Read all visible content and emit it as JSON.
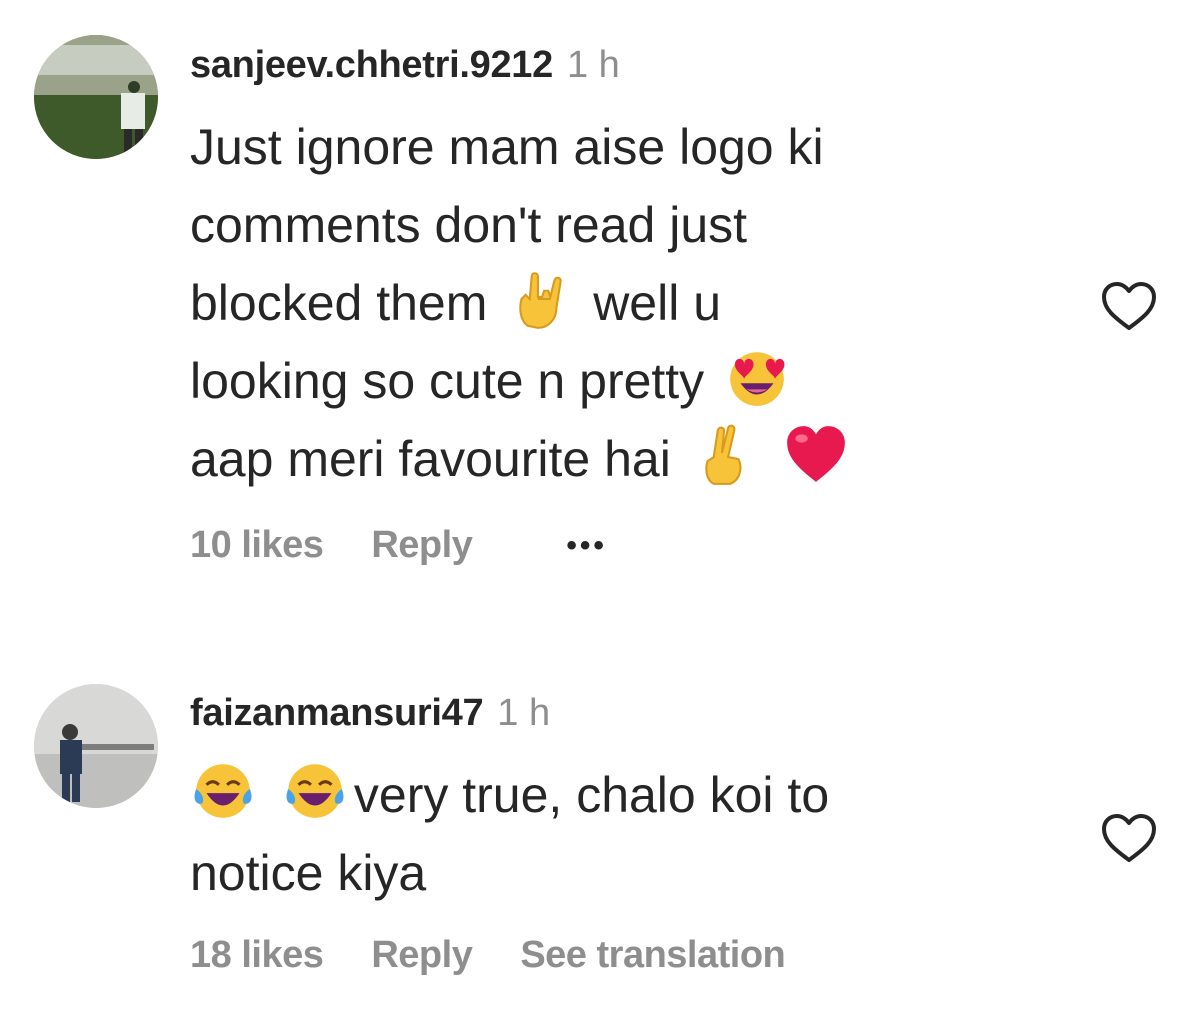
{
  "comments": [
    {
      "username": "sanjeev.chhetri.9212",
      "time": "1 h",
      "lines": [
        [
          "Just ignore mam aise logo ki"
        ],
        [
          "comments don't read just"
        ],
        [
          "blocked them",
          "well u"
        ],
        [
          "looking so cute n pretty"
        ],
        [
          "aap meri favourite hai"
        ]
      ],
      "emoji_icons": [
        "rock-on-hand-emoji",
        "heart-eyes-emoji",
        "crossed-fingers-emoji",
        "red-heart-emoji"
      ],
      "likes": "10 likes",
      "reply_label": "Reply",
      "more_label": "•••"
    },
    {
      "username": "faizanmansuri47",
      "time": "1 h",
      "lines": [
        [
          "very true, chalo koi to"
        ],
        [
          "notice kiya"
        ]
      ],
      "emoji_icons": [
        "tears-of-joy-emoji",
        "tears-of-joy-emoji"
      ],
      "likes": "18 likes",
      "reply_label": "Reply",
      "translate_label": "See translation"
    }
  ],
  "colors": {
    "text": "#262626",
    "muted": "#8e8e8e",
    "emoji_yellow": "#f7c338",
    "heart_red": "#e8194e"
  }
}
